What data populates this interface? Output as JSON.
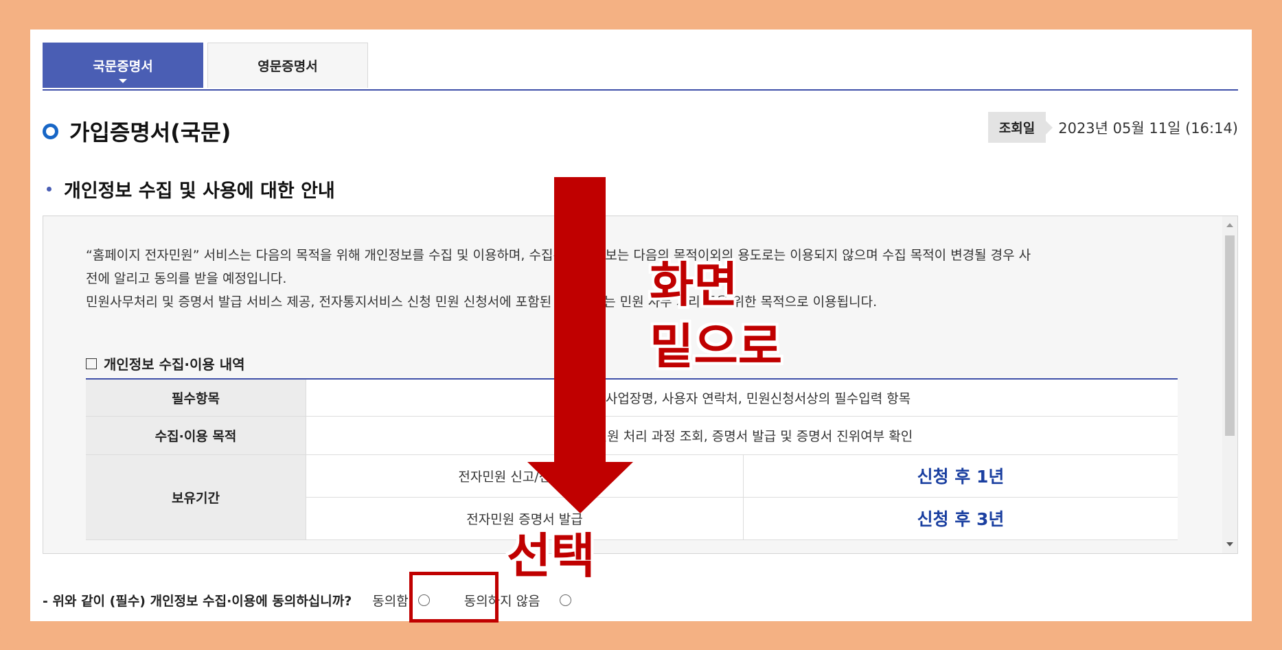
{
  "tabs": [
    {
      "label": "국문증명서",
      "active": true
    },
    {
      "label": "영문증명서",
      "active": false
    }
  ],
  "page_title": "가입증명서(국문)",
  "lookup": {
    "badge": "조회일",
    "date": "2023년 05월 11일 (16:14)"
  },
  "section_title": "개인정보 수집 및 사용에 대한 안내",
  "notice_lines": [
    "“홈페이지 전자민원” 서비스는 다음의 목적을 위해 개인정보를 수집 및 이용하며, 수집된 개인정보는 다음의 목적이외의 용도로는 이용되지 않으며 수집 목적이 변경될 경우 사",
    "전에 알리고 동의를 받을 예정입니다.",
    "민원사무처리 및 증명서 발급 서비스 제공, 전자통지서비스 신청 민원 신청서에 포함된 개인정보는 민원 사무 처리 등을 위한 목적으로 이용됩니다."
  ],
  "details": {
    "heading": "개인정보 수집·이용 내역",
    "rows": {
      "required": {
        "label": "필수항목",
        "value": "성명, 사업장명, 사용자 연락처, 민원신청서상의 필수입력 항목"
      },
      "purpose": {
        "label": "수집·이용 목적",
        "value": "전자민원 처리 과정 조회, 증명서 발급 및 증명서 진위여부 확인"
      },
      "retention": {
        "label": "보유기간",
        "items": [
          {
            "type": "전자민원 신고/신청서 등",
            "period": "신청 후 1년"
          },
          {
            "type": "전자민원 증명서 발급",
            "period": "신청 후 3년"
          }
        ]
      }
    }
  },
  "consent": {
    "question": "- 위와 같이 (필수) 개인정보 수집·이용에 동의하십니까?",
    "agree": "동의함",
    "disagree": "동의하지 않음"
  },
  "annotations": {
    "scroll_line1": "화면",
    "scroll_line2": "밑으로",
    "select": "선택",
    "color": "#c00000"
  },
  "colors": {
    "accent": "#4a5eb4",
    "title_marker": "#1766c6",
    "frame": "#f4b183"
  }
}
